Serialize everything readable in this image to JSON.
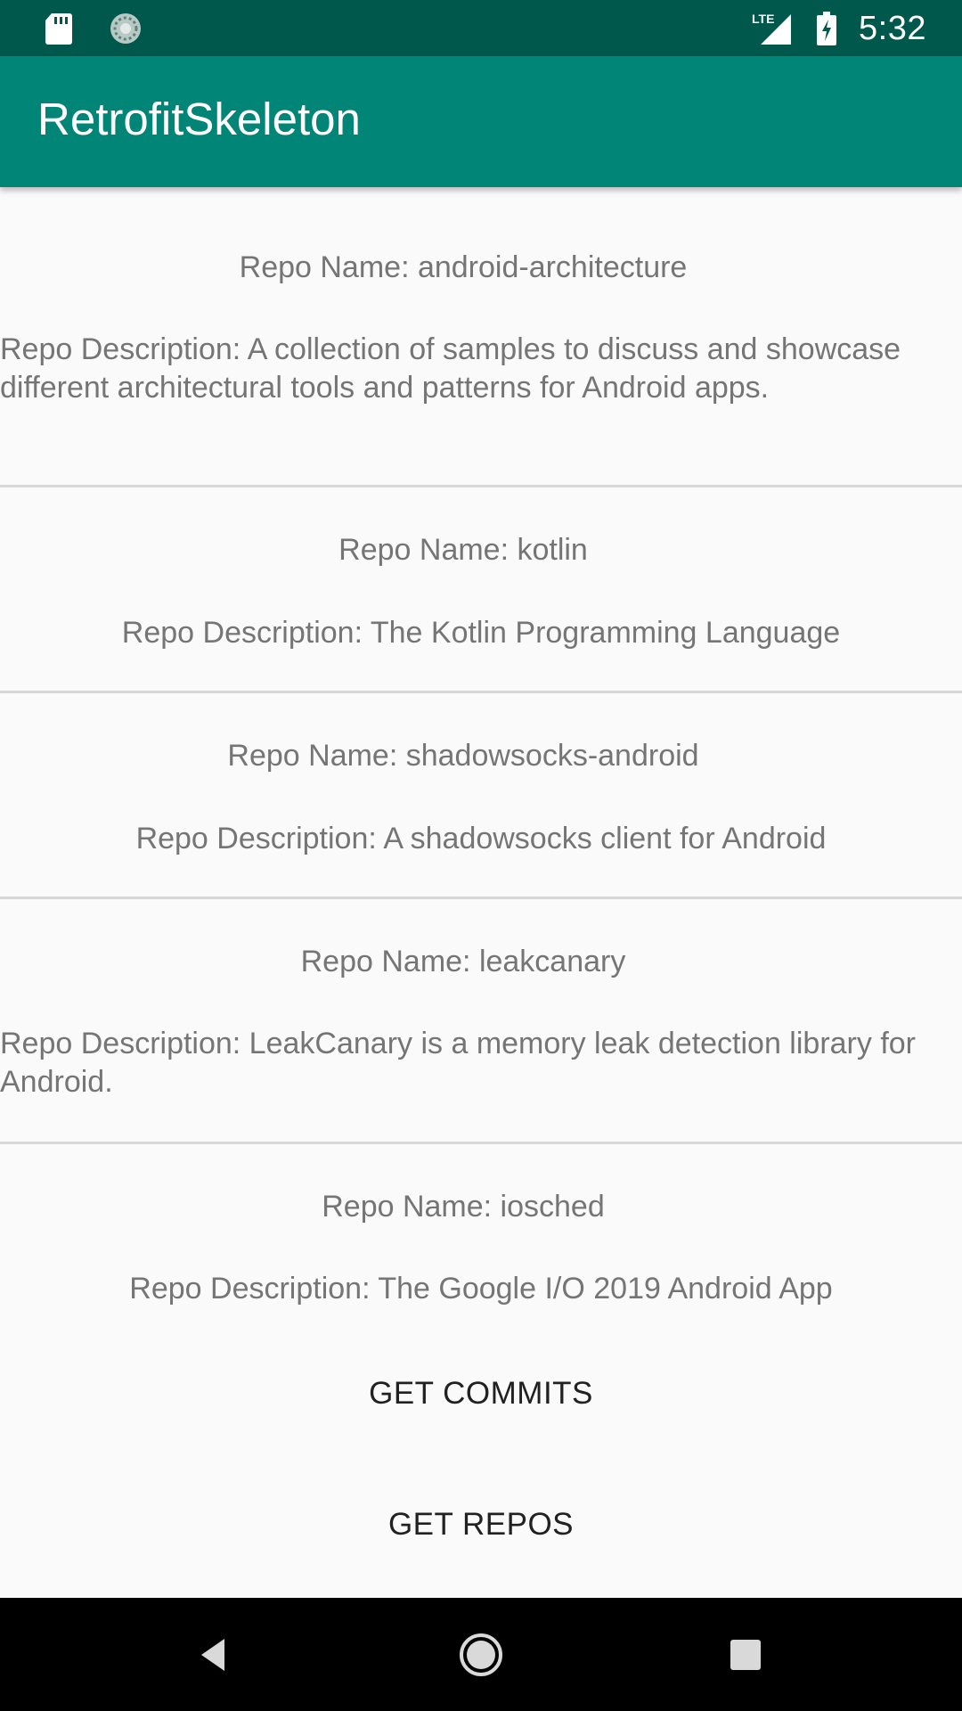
{
  "status_bar": {
    "time": "5:32",
    "network": "LTE",
    "background_color": "#00574b"
  },
  "app_bar": {
    "title": "RetrofitSkeleton",
    "background_color": "#008577"
  },
  "repos": [
    {
      "name": "Repo Name: android-architecture",
      "description": "Repo Description: A collection of samples to discuss and showcase different architectural tools and patterns for Android apps."
    },
    {
      "name": "Repo Name: kotlin",
      "description": "Repo Description: The Kotlin Programming Language"
    },
    {
      "name": "Repo Name: shadowsocks-android",
      "description": "Repo Description: A shadowsocks client for Android"
    },
    {
      "name": "Repo Name: leakcanary",
      "description": "Repo Description: LeakCanary is a memory leak detection library for Android."
    },
    {
      "name": "Repo Name: iosched",
      "description": "Repo Description: The Google I/O 2019 Android App"
    }
  ],
  "buttons": {
    "get_commits": "GET COMMITS",
    "get_repos": "GET REPOS"
  },
  "nav_bar": {
    "icons": [
      "back-icon",
      "home-icon",
      "recents-icon"
    ]
  }
}
